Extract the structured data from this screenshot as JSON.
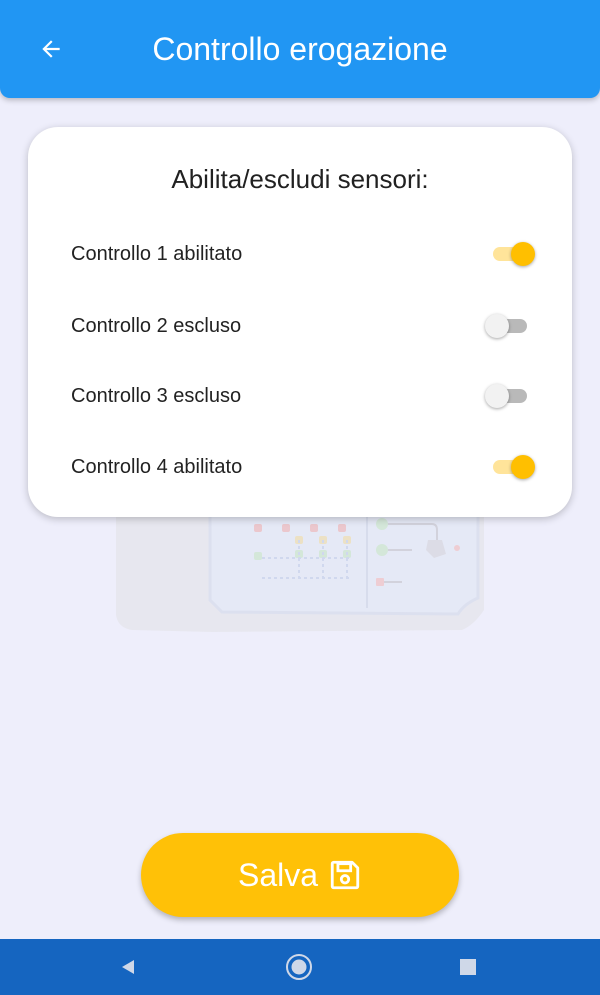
{
  "appbar": {
    "title": "Controllo erogazione",
    "back_icon": "arrow-left-icon",
    "color": "#2196f3"
  },
  "card": {
    "title": "Abilita/escludi sensori:",
    "switches": [
      {
        "label": "Controllo 1 abilitato",
        "enabled": true
      },
      {
        "label": "Controllo 2 escluso",
        "enabled": false
      },
      {
        "label": "Controllo 3 escluso",
        "enabled": false
      },
      {
        "label": "Controllo 4 abilitato",
        "enabled": true
      }
    ]
  },
  "save_button": {
    "label": "Salva",
    "icon": "floppy-disk-icon",
    "color": "#ffc107"
  },
  "navbar": {
    "color": "#1565c0",
    "buttons": [
      "back-triangle-icon",
      "home-circle-icon",
      "recents-square-icon"
    ]
  }
}
